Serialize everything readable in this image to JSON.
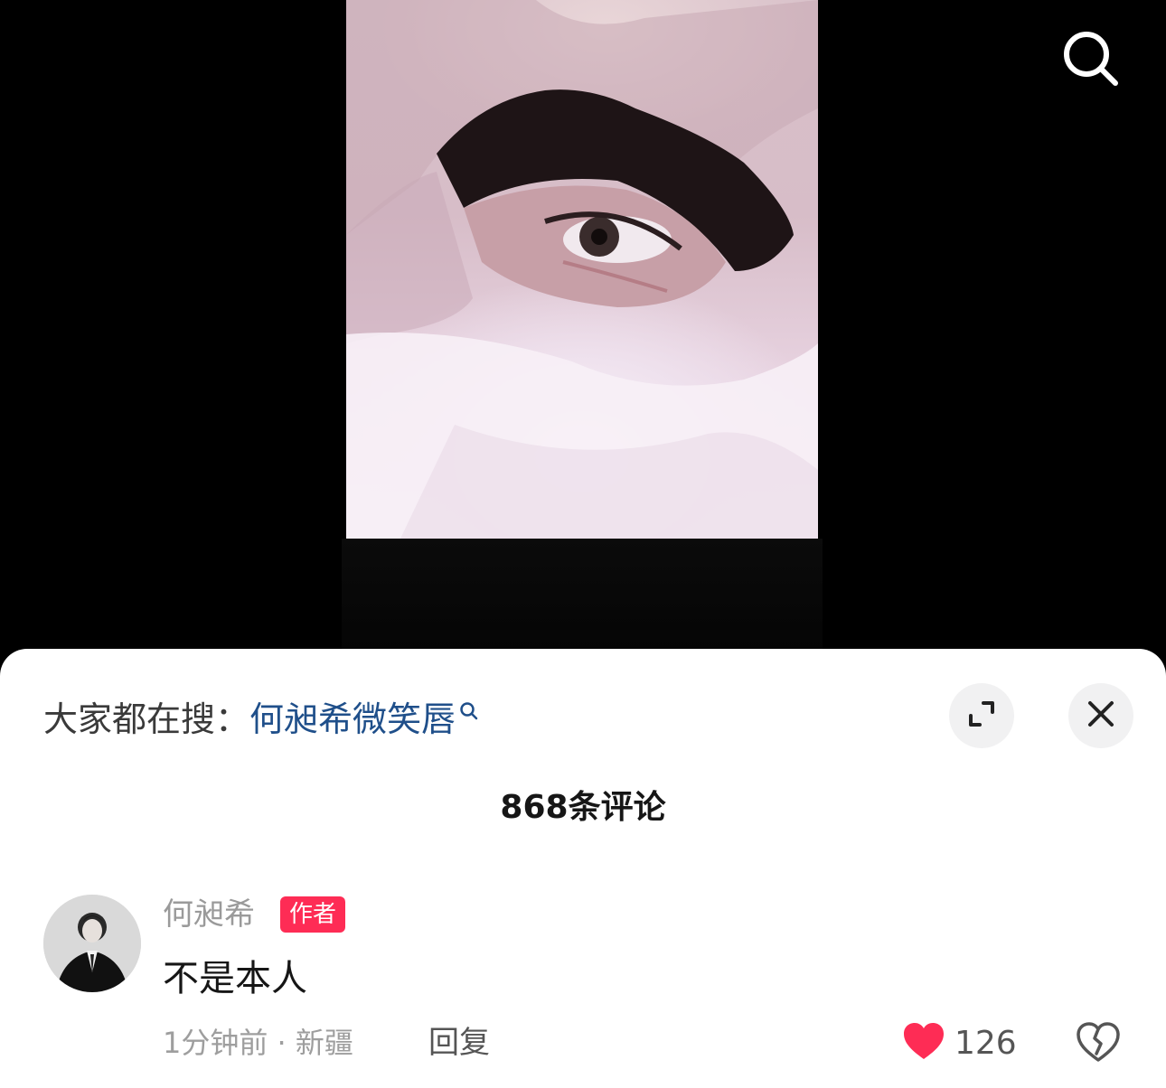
{
  "video": {
    "image_desc": "close-up photo of an eye framed by hands"
  },
  "top": {
    "search_icon": "search-icon"
  },
  "sheet": {
    "hot_search_prefix": "大家都在搜：",
    "hot_search_keyword": "何昶希微笑唇",
    "expand_icon": "expand-icon",
    "close_icon": "close-icon",
    "comment_count": "868条评论"
  },
  "comments": [
    {
      "username": "何昶希",
      "badge": "作者",
      "text": "不是本人",
      "time_location": "1分钟前 · 新疆",
      "reply_label": "回复",
      "likes": "126",
      "liked": true
    }
  ],
  "colors": {
    "accent_red": "#fe2c55",
    "keyword_blue": "#1f4f8a"
  }
}
